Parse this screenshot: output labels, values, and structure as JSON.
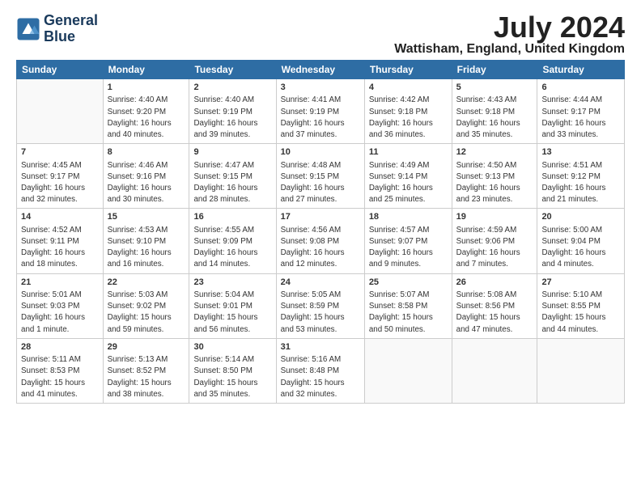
{
  "logo": {
    "line1": "General",
    "line2": "Blue"
  },
  "title": "July 2024",
  "location": "Wattisham, England, United Kingdom",
  "days_of_week": [
    "Sunday",
    "Monday",
    "Tuesday",
    "Wednesday",
    "Thursday",
    "Friday",
    "Saturday"
  ],
  "weeks": [
    [
      {
        "day": "",
        "info": ""
      },
      {
        "day": "1",
        "info": "Sunrise: 4:40 AM\nSunset: 9:20 PM\nDaylight: 16 hours\nand 40 minutes."
      },
      {
        "day": "2",
        "info": "Sunrise: 4:40 AM\nSunset: 9:19 PM\nDaylight: 16 hours\nand 39 minutes."
      },
      {
        "day": "3",
        "info": "Sunrise: 4:41 AM\nSunset: 9:19 PM\nDaylight: 16 hours\nand 37 minutes."
      },
      {
        "day": "4",
        "info": "Sunrise: 4:42 AM\nSunset: 9:18 PM\nDaylight: 16 hours\nand 36 minutes."
      },
      {
        "day": "5",
        "info": "Sunrise: 4:43 AM\nSunset: 9:18 PM\nDaylight: 16 hours\nand 35 minutes."
      },
      {
        "day": "6",
        "info": "Sunrise: 4:44 AM\nSunset: 9:17 PM\nDaylight: 16 hours\nand 33 minutes."
      }
    ],
    [
      {
        "day": "7",
        "info": "Sunrise: 4:45 AM\nSunset: 9:17 PM\nDaylight: 16 hours\nand 32 minutes."
      },
      {
        "day": "8",
        "info": "Sunrise: 4:46 AM\nSunset: 9:16 PM\nDaylight: 16 hours\nand 30 minutes."
      },
      {
        "day": "9",
        "info": "Sunrise: 4:47 AM\nSunset: 9:15 PM\nDaylight: 16 hours\nand 28 minutes."
      },
      {
        "day": "10",
        "info": "Sunrise: 4:48 AM\nSunset: 9:15 PM\nDaylight: 16 hours\nand 27 minutes."
      },
      {
        "day": "11",
        "info": "Sunrise: 4:49 AM\nSunset: 9:14 PM\nDaylight: 16 hours\nand 25 minutes."
      },
      {
        "day": "12",
        "info": "Sunrise: 4:50 AM\nSunset: 9:13 PM\nDaylight: 16 hours\nand 23 minutes."
      },
      {
        "day": "13",
        "info": "Sunrise: 4:51 AM\nSunset: 9:12 PM\nDaylight: 16 hours\nand 21 minutes."
      }
    ],
    [
      {
        "day": "14",
        "info": "Sunrise: 4:52 AM\nSunset: 9:11 PM\nDaylight: 16 hours\nand 18 minutes."
      },
      {
        "day": "15",
        "info": "Sunrise: 4:53 AM\nSunset: 9:10 PM\nDaylight: 16 hours\nand 16 minutes."
      },
      {
        "day": "16",
        "info": "Sunrise: 4:55 AM\nSunset: 9:09 PM\nDaylight: 16 hours\nand 14 minutes."
      },
      {
        "day": "17",
        "info": "Sunrise: 4:56 AM\nSunset: 9:08 PM\nDaylight: 16 hours\nand 12 minutes."
      },
      {
        "day": "18",
        "info": "Sunrise: 4:57 AM\nSunset: 9:07 PM\nDaylight: 16 hours\nand 9 minutes."
      },
      {
        "day": "19",
        "info": "Sunrise: 4:59 AM\nSunset: 9:06 PM\nDaylight: 16 hours\nand 7 minutes."
      },
      {
        "day": "20",
        "info": "Sunrise: 5:00 AM\nSunset: 9:04 PM\nDaylight: 16 hours\nand 4 minutes."
      }
    ],
    [
      {
        "day": "21",
        "info": "Sunrise: 5:01 AM\nSunset: 9:03 PM\nDaylight: 16 hours\nand 1 minute."
      },
      {
        "day": "22",
        "info": "Sunrise: 5:03 AM\nSunset: 9:02 PM\nDaylight: 15 hours\nand 59 minutes."
      },
      {
        "day": "23",
        "info": "Sunrise: 5:04 AM\nSunset: 9:01 PM\nDaylight: 15 hours\nand 56 minutes."
      },
      {
        "day": "24",
        "info": "Sunrise: 5:05 AM\nSunset: 8:59 PM\nDaylight: 15 hours\nand 53 minutes."
      },
      {
        "day": "25",
        "info": "Sunrise: 5:07 AM\nSunset: 8:58 PM\nDaylight: 15 hours\nand 50 minutes."
      },
      {
        "day": "26",
        "info": "Sunrise: 5:08 AM\nSunset: 8:56 PM\nDaylight: 15 hours\nand 47 minutes."
      },
      {
        "day": "27",
        "info": "Sunrise: 5:10 AM\nSunset: 8:55 PM\nDaylight: 15 hours\nand 44 minutes."
      }
    ],
    [
      {
        "day": "28",
        "info": "Sunrise: 5:11 AM\nSunset: 8:53 PM\nDaylight: 15 hours\nand 41 minutes."
      },
      {
        "day": "29",
        "info": "Sunrise: 5:13 AM\nSunset: 8:52 PM\nDaylight: 15 hours\nand 38 minutes."
      },
      {
        "day": "30",
        "info": "Sunrise: 5:14 AM\nSunset: 8:50 PM\nDaylight: 15 hours\nand 35 minutes."
      },
      {
        "day": "31",
        "info": "Sunrise: 5:16 AM\nSunset: 8:48 PM\nDaylight: 15 hours\nand 32 minutes."
      },
      {
        "day": "",
        "info": ""
      },
      {
        "day": "",
        "info": ""
      },
      {
        "day": "",
        "info": ""
      }
    ]
  ]
}
